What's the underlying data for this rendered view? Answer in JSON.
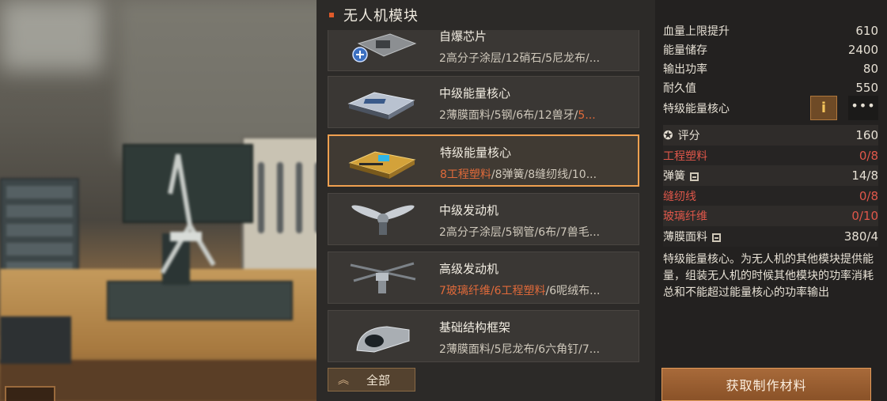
{
  "panel": {
    "title": "无人机模块"
  },
  "items": [
    {
      "name": "自爆芯片",
      "mats_plain": "2高分子涂层/12硝石/5尼龙布/...",
      "mats_red": "",
      "icon": "chip-icon"
    },
    {
      "name": "中级能量核心",
      "mats_plain": "2薄膜面料/5钢/6布/12兽牙/",
      "mats_red": "5...",
      "icon": "battery-icon"
    },
    {
      "name": "特级能量核心",
      "mats_red_lead": "8工程塑料",
      "mats_plain": "/8弹簧/8缝纫线/10...",
      "icon": "gold-battery-icon"
    },
    {
      "name": "中级发动机",
      "mats_plain": "2高分子涂层/5钢管/6布/7兽毛...",
      "mats_red": "",
      "icon": "propeller-icon"
    },
    {
      "name": "高级发动机",
      "mats_red_lead": "7玻璃纤维/6工程塑料",
      "mats_plain": "/6呢绒布...",
      "icon": "rotor-icon"
    },
    {
      "name": "基础结构框架",
      "mats_plain": "2薄膜面料/5尼龙布/6六角钉/7...",
      "mats_red": "",
      "icon": "frame-icon"
    }
  ],
  "footer": {
    "all_label": "全部"
  },
  "stats": {
    "hp_label": "血量上限提升",
    "hp_value": "610",
    "energy_label": "能量储存",
    "energy_value": "2400",
    "power_label": "输出功率",
    "power_value": "80",
    "durability_label": "耐久值",
    "durability_value": "550",
    "core_label": "特级能量核心",
    "info_label": "i",
    "more_label": "•••",
    "score_label": "评分",
    "score_value": "160"
  },
  "requirements": [
    {
      "name": "工程塑料",
      "value": "0/8",
      "bad": true
    },
    {
      "name": "弹簧",
      "value": "14/8",
      "bad": false,
      "stored": true
    },
    {
      "name": "缝纫线",
      "value": "0/8",
      "bad": true
    },
    {
      "name": "玻璃纤维",
      "value": "0/10",
      "bad": true
    },
    {
      "name": "薄膜面料",
      "value": "380/4",
      "bad": false,
      "stored": true
    }
  ],
  "description": "特级能量核心。为无人机的其他模块提供能量，组装无人机的时候其他模块的功率消耗总和不能超过能量核心的功率输出",
  "craft_button": "获取制作材料",
  "colors": {
    "accent": "#f0a050",
    "warning": "#e0574a",
    "orange_text": "#e06a3a"
  }
}
